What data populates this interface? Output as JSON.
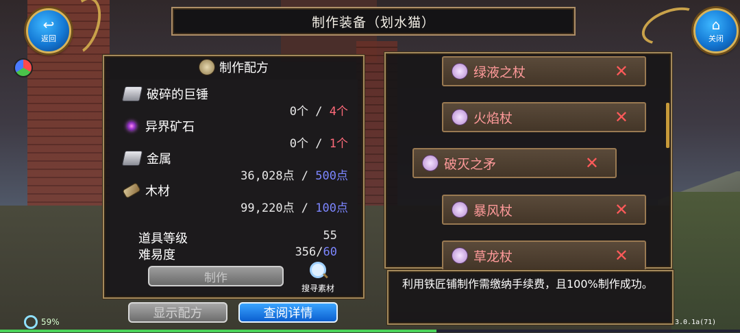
{
  "title": "制作装备（划水猫）",
  "top_left_button": {
    "label": "返回",
    "icon": "return-arrow-icon"
  },
  "top_right_button": {
    "label": "关闭",
    "icon": "home-icon"
  },
  "recipe_panel": {
    "header": "制作配方",
    "materials": [
      {
        "name": "破碎的巨锤",
        "icon": "hammer-icon",
        "have": "0个",
        "sep": " / ",
        "need": "4个",
        "need_color": "red"
      },
      {
        "name": "异界矿石",
        "icon": "ore-icon",
        "have": "0个",
        "sep": " / ",
        "need": "1个",
        "need_color": "red"
      },
      {
        "name": "金属",
        "icon": "metal-icon",
        "have": "36,028点",
        "sep": " / ",
        "need": "500点",
        "need_color": "blue"
      },
      {
        "name": "木材",
        "icon": "wood-icon",
        "have": "99,220点",
        "sep": " / ",
        "need": "100点",
        "need_color": "blue"
      }
    ],
    "stats": {
      "item_level_label": "道具等级",
      "item_level_value": "55",
      "difficulty_label": "难易度",
      "difficulty_value": "356/",
      "difficulty_target": "60"
    },
    "craft_button": "制作",
    "search_label": "搜寻素材"
  },
  "equipment_list": [
    {
      "name": "绿液之杖",
      "selected": false
    },
    {
      "name": "火焰杖",
      "selected": false
    },
    {
      "name": "破灭之矛",
      "selected": true
    },
    {
      "name": "暴风杖",
      "selected": false
    },
    {
      "name": "草龙杖",
      "selected": false
    }
  ],
  "description": "利用铁匠铺制作需缴纳手续费，且100%制作成功。",
  "bottom_buttons": {
    "show_recipe": "显示配方",
    "view_details": "查阅详情"
  },
  "status": {
    "percent": "59%",
    "progress": 0.59,
    "version": "3.0.1a(71)"
  },
  "colors": {
    "need_red": "#ff6a7a",
    "need_blue": "#7c86ff",
    "frame_gold": "#a58a5c",
    "item_text": "#ff9a9a"
  }
}
